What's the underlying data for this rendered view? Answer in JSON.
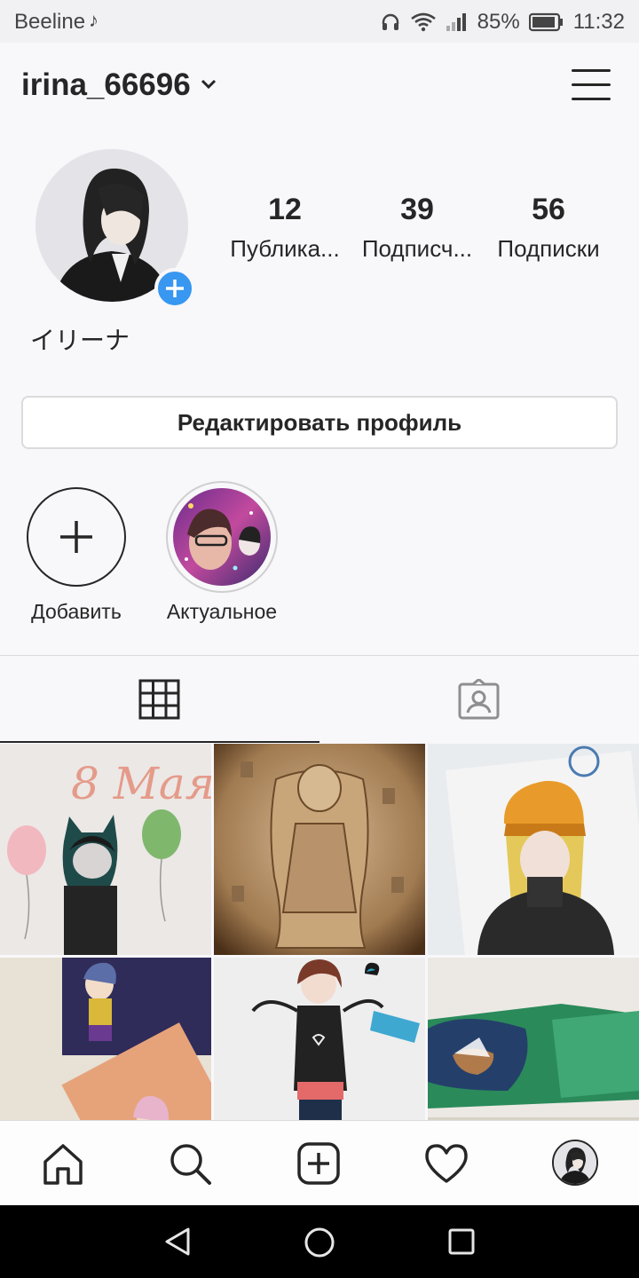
{
  "status_bar": {
    "carrier": "Beeline",
    "tiktok_icon": "tiktok-icon",
    "battery": "85%",
    "time": "11:32"
  },
  "header": {
    "username": "irina_66696",
    "menu_icon": "hamburger-menu-icon"
  },
  "profile": {
    "display_name": "イリーナ",
    "stats": [
      {
        "value": "12",
        "label": "Публика..."
      },
      {
        "value": "39",
        "label": "Подписч..."
      },
      {
        "value": "56",
        "label": "Подписки"
      }
    ],
    "edit_button": "Редактировать профиль"
  },
  "highlights": {
    "add_label": "Добавить",
    "story_label": "Актуальное"
  },
  "tabs": [
    {
      "name": "grid",
      "icon": "grid-icon",
      "active": true
    },
    {
      "name": "tagged",
      "icon": "tagged-person-icon",
      "active": false
    }
  ],
  "grid_posts": [
    {
      "text": "8 Мая"
    },
    {
      "text": ""
    },
    {
      "text": ""
    },
    {
      "text": ""
    },
    {
      "text": ""
    },
    {
      "text": ""
    }
  ],
  "bottom_nav": [
    "home-icon",
    "search-icon",
    "new-post-icon",
    "activity-heart-icon",
    "profile-avatar"
  ],
  "system_nav": [
    "back-icon",
    "home-circle-icon",
    "recents-icon"
  ],
  "colors": {
    "accent_blue": "#3897f0",
    "text": "#262626",
    "border": "#dbdbdb",
    "background": "#f8f7fa"
  }
}
